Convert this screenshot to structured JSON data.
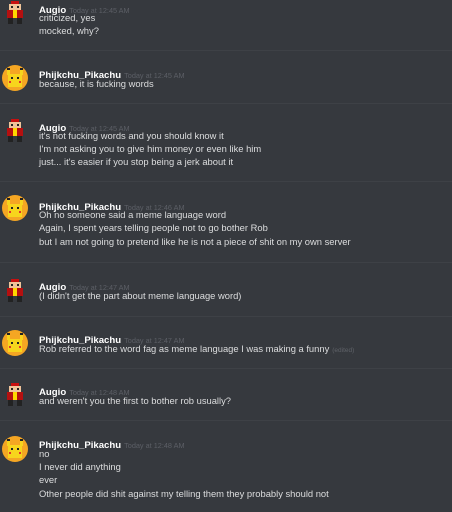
{
  "colors": {
    "background": "#36393e",
    "username": "#ffffff",
    "text": "#dcddde",
    "timestamp": "#5c5f66",
    "separator": "#3e4146"
  },
  "messages": [
    {
      "author": "Augio",
      "avatar_icon": "augio-avatar-icon",
      "timestamp": "Today at 12:45 AM",
      "lines": [
        "criticized, yes",
        "mocked, why?"
      ]
    },
    {
      "author": "Phijkchu_Pikachu",
      "avatar_icon": "pikachu-avatar-icon",
      "timestamp": "Today at 12:45 AM",
      "lines": [
        "because, it is fucking words"
      ]
    },
    {
      "author": "Augio",
      "avatar_icon": "augio-avatar-icon",
      "timestamp": "Today at 12:45 AM",
      "lines": [
        "it's not fucking words and you should know it",
        "I'm not asking you to give him money or even like him",
        "just... it's easier if you stop being a jerk about it"
      ]
    },
    {
      "author": "Phijkchu_Pikachu",
      "avatar_icon": "pikachu-avatar-icon",
      "timestamp": "Today at 12:46 AM",
      "lines": [
        "Oh no someone said a meme language word",
        "Again, I spent years telling people not to go bother Rob",
        "but I am not going to pretend like he is not a piece of shit on my own server"
      ]
    },
    {
      "author": "Augio",
      "avatar_icon": "augio-avatar-icon",
      "timestamp": "Today at 12:47 AM",
      "lines": [
        "(I didn't get the part about meme language word)"
      ]
    },
    {
      "author": "Phijkchu_Pikachu",
      "avatar_icon": "pikachu-avatar-icon",
      "timestamp": "Today at 12:47 AM",
      "lines": [
        "Rob referred to the word fag as meme language I was making a funny"
      ],
      "edited_label": "(edited)"
    },
    {
      "author": "Augio",
      "avatar_icon": "augio-avatar-icon",
      "timestamp": "Today at 12:48 AM",
      "lines": [
        "and weren't you the first to bother rob usually?"
      ]
    },
    {
      "author": "Phijkchu_Pikachu",
      "avatar_icon": "pikachu-avatar-icon",
      "timestamp": "Today at 12:48 AM",
      "lines": [
        "no",
        "I never did anything",
        "ever",
        "Other people did shit against my telling them they probably should not"
      ]
    }
  ]
}
